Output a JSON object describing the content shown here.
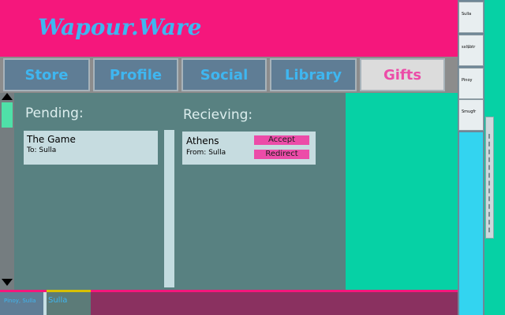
{
  "app": {
    "title": "Wapour.Ware"
  },
  "nav": {
    "tabs": [
      {
        "label": "Store"
      },
      {
        "label": "Profile"
      },
      {
        "label": "Social"
      },
      {
        "label": "Library"
      },
      {
        "label": "Gifts",
        "active": true
      }
    ]
  },
  "gifts": {
    "pending": {
      "title": "Pending:",
      "items": [
        {
          "name": "The Game",
          "to": "To: Sulla"
        }
      ]
    },
    "receiving": {
      "title": "Recieving:",
      "items": [
        {
          "name": "Athens",
          "from": "From: Sulla",
          "accept_label": "Accept",
          "redirect_label": "Redirect"
        }
      ]
    }
  },
  "friends": [
    "Sulla",
    "sxl$btr",
    "Pinoy",
    "Smugfr"
  ],
  "chats": [
    {
      "label": "Pinoy, Sulla"
    },
    {
      "label": "Sulla"
    }
  ],
  "colors": {
    "accent": "#f5177c",
    "link": "#3fb6f0",
    "active_tab_text": "#ec4ca8",
    "panel": "#588181",
    "teal": "#06d1a5"
  }
}
